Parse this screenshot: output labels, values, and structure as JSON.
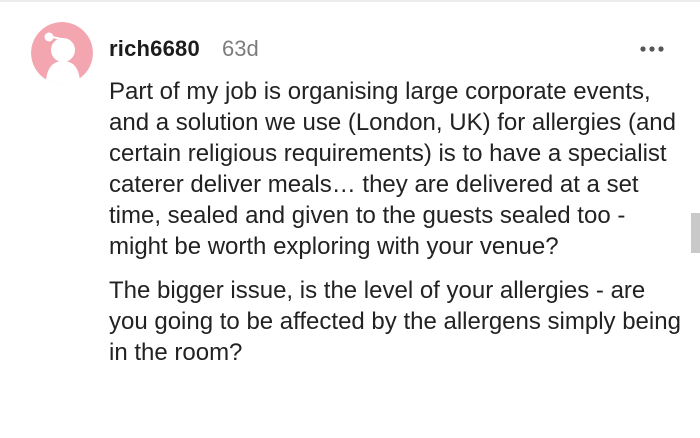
{
  "comment": {
    "username": "rich6680",
    "age": "63d",
    "paragraphs": [
      "Part of my job is organising large corporate events, and a solution we use (London, UK) for allergies (and certain religious requirements) is to have a specialist caterer deliver meals… they are delivered at a set time, sealed and given to the guests sealed too - might be worth exploring with your venue?",
      "The bigger issue, is the level of your allergies - are you going to be affected by the allergens simply being in the room?"
    ]
  },
  "icons": {
    "avatar": "reddit-snoo-avatar",
    "more": "more-options-icon"
  },
  "colors": {
    "avatar_background": "#f4a6b0",
    "avatar_figure": "#ffffff",
    "username": "#1c1c1c",
    "timestamp": "#7c7c7c",
    "body_text": "#222222"
  }
}
